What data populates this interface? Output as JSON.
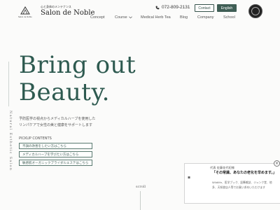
{
  "header": {
    "brand_tag": "心と身体のメンテナンス",
    "brand_name": "Salon de Noble",
    "logo_sub": "Salon de Noble",
    "phone": "072-809-2131",
    "contact_label": "Contact",
    "english_label": "English"
  },
  "nav": {
    "items": [
      "Concept",
      "Course",
      "Medical Herb Tea",
      "Blog",
      "Company",
      "School"
    ]
  },
  "hero": {
    "title_line1": "Bring out",
    "title_line2": "Beauty.",
    "vertical_text": "Natural Esthetic Salon",
    "desc_line1": "予防医学の視点からメディカルハーブを使用した",
    "desc_line2": "リンパケアで女性の美と健康をサポートします",
    "pickup_label": "PICKUP CONTENTS",
    "pickup": [
      "不調の改善をしたい方はこちら",
      "メディカルハーブを学びたい方はこちら",
      "敏感肌オーガニックブライダルエステはこちら"
    ],
    "scroll": "scroll"
  },
  "popup": {
    "close": "×",
    "image_alt": "",
    "role": "代表 佐藤花代紀様",
    "quote": "「その常識、あなたの老化を早めます。」",
    "body": "Wildlife、医学ブック、鉛筆雑誌、ジュンク堂、他多、天知書店人等でお買い求めいただけます"
  },
  "colors": {
    "accent": "#2e5a50",
    "button": "#3f5e55"
  }
}
